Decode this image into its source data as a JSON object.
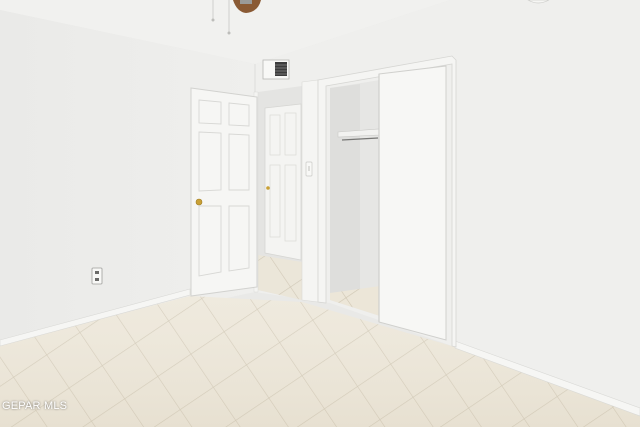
{
  "watermark": {
    "text": "GEPAR MLS"
  },
  "colors": {
    "ceiling": "#f2f2f0",
    "left_wall": "#ececea",
    "right_wall": "#efefed",
    "floor_tile": "#ece6d8",
    "grout": "#cfc6b3",
    "door": "#f6f6f4",
    "trim": "#f3f3f1",
    "fan_blade": "#8a5a34",
    "door_knob": "#c9a035"
  },
  "icons": {
    "ceiling_fan": "ceiling-fan-icon",
    "air_vent": "air-vent-icon",
    "outlet": "electrical-outlet-icon",
    "light_switch": "light-switch-icon",
    "door_knob": "door-knob-icon"
  }
}
